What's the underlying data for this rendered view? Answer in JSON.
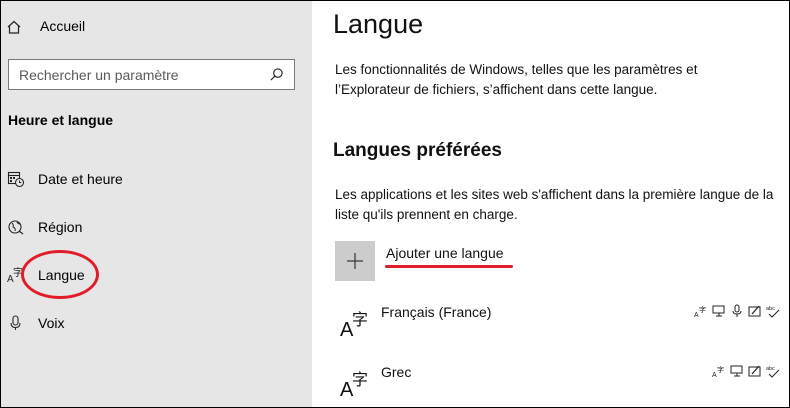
{
  "sidebar": {
    "home_label": "Accueil",
    "search_placeholder": "Rechercher un paramètre",
    "section_title": "Heure et langue",
    "items": [
      {
        "label": "Date et heure",
        "icon": "calendar-clock-icon"
      },
      {
        "label": "Région",
        "icon": "globe-icon"
      },
      {
        "label": "Langue",
        "icon": "language-icon"
      },
      {
        "label": "Voix",
        "icon": "microphone-icon"
      }
    ]
  },
  "main": {
    "title": "Langue",
    "display_desc": "Les fonctionnalités de Windows, telles que les paramètres et l’Explorateur de fichiers, s’affichent dans cette langue.",
    "preferred_title": "Langues préférées",
    "preferred_desc": "Les applications et les sites web s'affichent dans la première langue de la liste qu'ils prennent en charge.",
    "add_label": "Ajouter une langue",
    "languages": [
      {
        "name": "Français (France)"
      },
      {
        "name": "Grec"
      }
    ]
  },
  "annotation_color": "#e11d2a"
}
